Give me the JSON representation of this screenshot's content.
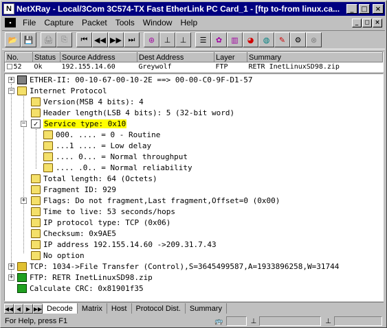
{
  "window": {
    "title": "NetXRay - Local/3Com 3C574-TX Fast EtherLink PC Card_1 - [ftp to-from linux.ca...",
    "app_icon": "N",
    "minimize": "_",
    "maximize": "□",
    "close": "×"
  },
  "menu": {
    "items": [
      {
        "label": "File"
      },
      {
        "label": "Capture"
      },
      {
        "label": "Packet"
      },
      {
        "label": "Tools"
      },
      {
        "label": "Window"
      },
      {
        "label": "Help"
      }
    ],
    "mdi_min": "_",
    "mdi_restore": "◻",
    "mdi_close": "×"
  },
  "toolbar": {
    "buttons": [
      {
        "icon": "open-folder-icon",
        "glyph": "📂"
      },
      {
        "icon": "save-icon",
        "glyph": "💾"
      },
      {
        "icon": "print-icon",
        "glyph": "🖨"
      },
      {
        "icon": "copy-icon",
        "glyph": "⎘"
      },
      {
        "icon": "first-icon",
        "glyph": "⏮"
      },
      {
        "icon": "prev-icon",
        "glyph": "◀◀"
      },
      {
        "icon": "next-icon",
        "glyph": "▶▶"
      },
      {
        "icon": "last-icon",
        "glyph": "⏭"
      },
      {
        "icon": "record-icon",
        "glyph": "⊛"
      },
      {
        "icon": "decode-icon",
        "glyph": "⊥"
      },
      {
        "icon": "decode2-icon",
        "glyph": "⊥"
      },
      {
        "icon": "packet-list-icon",
        "glyph": "☰"
      },
      {
        "icon": "matrix-icon",
        "glyph": "✿"
      },
      {
        "icon": "bar-chart-icon",
        "glyph": "▥"
      },
      {
        "icon": "pie-chart-icon",
        "glyph": "◕"
      },
      {
        "icon": "globe-icon",
        "glyph": "◍"
      },
      {
        "icon": "edit-icon",
        "glyph": "✎"
      },
      {
        "icon": "tools-icon",
        "glyph": "⚙"
      },
      {
        "icon": "stop-icon",
        "glyph": "⊗"
      }
    ]
  },
  "packet_list": {
    "columns": [
      "No.",
      "Status",
      "Source Address",
      "Dest Address",
      "Layer",
      "Summary"
    ],
    "rows": [
      {
        "no": "52",
        "status": "Ok",
        "source": "192.155.14.60",
        "dest": "Greywolf",
        "layer": "FTP",
        "summary": "RETR InetLinuxSD98.zip"
      }
    ]
  },
  "tree": {
    "nodes": [
      {
        "text": "ETHER-II: 00-10-67-00-10-2E ==> 00-00-C0-9F-D1-57"
      },
      {
        "text": "Internet Protocol"
      },
      {
        "text": "Version(MSB 4 bits): 4"
      },
      {
        "text": "Header length(LSB 4 bits): 5 (32-bit word)"
      },
      {
        "text": "Service type: 0x10"
      },
      {
        "text": "000. .... = 0 - Routine"
      },
      {
        "text": "...1 .... = Low delay"
      },
      {
        "text": ".... 0... = Normal throughput"
      },
      {
        "text": ".... .0.. = Normal reliability"
      },
      {
        "text": "Total length: 64 (Octets)"
      },
      {
        "text": "Fragment ID: 929"
      },
      {
        "text": "Flags: Do not fragment,Last fragment,Offset=0 (0x00)"
      },
      {
        "text": "Time to live: 53 seconds/hops"
      },
      {
        "text": "IP protocol type: TCP (0x06)"
      },
      {
        "text": "Checksum: 0x9AE5"
      },
      {
        "text": "IP address 192.155.14.60 ->209.31.7.43"
      },
      {
        "text": "No option"
      },
      {
        "text": "TCP: 1034->File Transfer (Control),S=3645499587,A=1933896258,W=31744"
      },
      {
        "text": "FTP: RETR InetLinuxSD98.zip"
      },
      {
        "text": "Calculate CRC: 0x81901f35"
      }
    ]
  },
  "tabs": {
    "items": [
      {
        "label": "Decode",
        "active": true
      },
      {
        "label": "Matrix",
        "active": false
      },
      {
        "label": "Host",
        "active": false
      },
      {
        "label": "Protocol Dist.",
        "active": false
      },
      {
        "label": "Summary",
        "active": false
      }
    ]
  },
  "status": {
    "text": "For Help, press F1"
  },
  "colors": {
    "titlebar": "#000080",
    "highlight": "#ffff00",
    "window_bg": "#c0c0c0"
  }
}
